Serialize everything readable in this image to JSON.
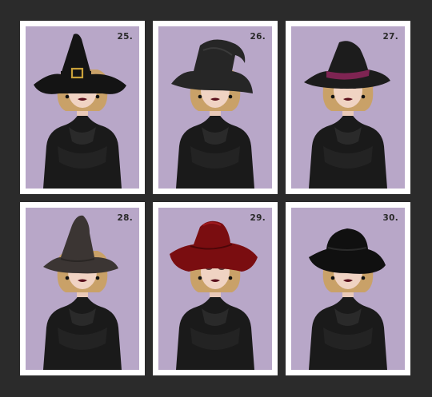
{
  "page": {
    "background": "#2b2b2b",
    "panel_background": "#b8a7c8",
    "card_border": "#ffffff"
  },
  "portraits": [
    {
      "number": "25.",
      "hat_style": "tall-pointed-witch-hat-with-buckle",
      "hat_color": "#141414",
      "band_color": "#141414",
      "buckle": true
    },
    {
      "number": "26.",
      "hat_style": "bent-tip-witch-hat",
      "hat_color": "#262626",
      "band_color": "#262626",
      "buckle": false
    },
    {
      "number": "27.",
      "hat_style": "witch-hat-with-plum-band",
      "hat_color": "#1c1c1c",
      "band_color": "#7e2452",
      "buckle": false
    },
    {
      "number": "28.",
      "hat_style": "tall-crooked-witch-hat",
      "hat_color": "#3b3533",
      "band_color": "#3b3533",
      "buckle": false
    },
    {
      "number": "29.",
      "hat_style": "red-velvet-witch-hat",
      "hat_color": "#7a0d10",
      "band_color": "#7a0d10",
      "buckle": false
    },
    {
      "number": "30.",
      "hat_style": "wide-brim-fedora-style-hat",
      "hat_color": "#101010",
      "band_color": "#101010",
      "buckle": false
    }
  ]
}
